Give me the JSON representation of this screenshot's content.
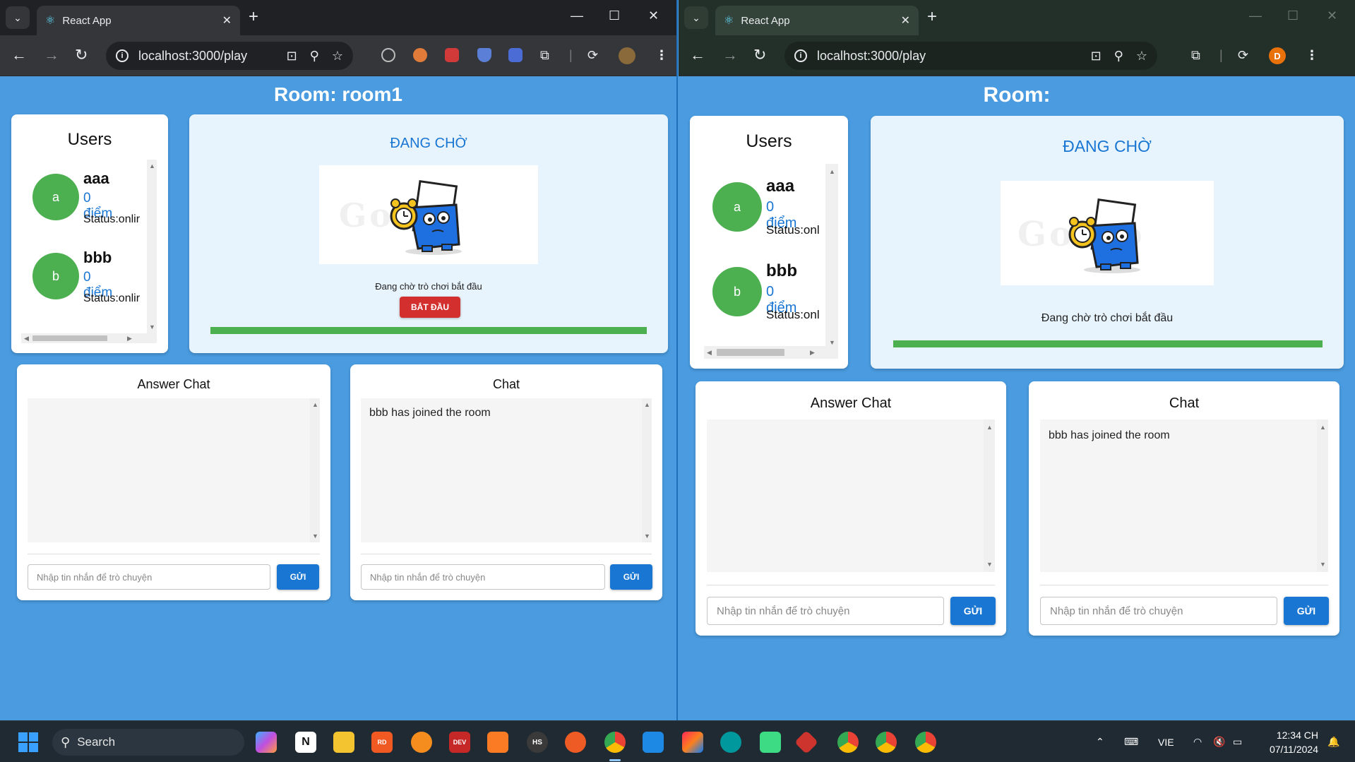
{
  "tab_title": "React App",
  "url": "localhost:3000/play",
  "windows": [
    {
      "room_title": "Room: room1",
      "users_title": "Users",
      "users": [
        {
          "initial": "a",
          "name": "aaa",
          "score": "0 điểm",
          "status": "Status:onlir"
        },
        {
          "initial": "b",
          "name": "bbb",
          "score": "0 điểm",
          "status": "Status:onlir"
        }
      ],
      "waiting_title": "ĐANG CHỜ",
      "waiting_watermark": "Go  .io",
      "waiting_text": "Đang chờ trò chơi bắt đầu",
      "start_button": "BẮT ĐẦU",
      "progress": 1.0,
      "answer_chat": {
        "title": "Answer Chat",
        "messages": [],
        "placeholder": "Nhập tin nhắn để trò chuyện",
        "send": "GỬI"
      },
      "chat": {
        "title": "Chat",
        "messages": [
          "bbb has joined the room"
        ],
        "placeholder": "Nhập tin nhắn để trò chuyện",
        "send": "GỬI"
      }
    },
    {
      "room_title": "Room:",
      "users_title": "Users",
      "users": [
        {
          "initial": "a",
          "name": "aaa",
          "score": "0 điểm",
          "status": "Status:onl"
        },
        {
          "initial": "b",
          "name": "bbb",
          "score": "0 điểm",
          "status": "Status:onl"
        }
      ],
      "waiting_title": "ĐANG CHỜ",
      "waiting_watermark": "Go  .io",
      "waiting_text": "Đang chờ trò chơi bắt đầu",
      "progress": 1.0,
      "answer_chat": {
        "title": "Answer Chat",
        "messages": [],
        "placeholder": "Nhập tin nhắn để trò chuyện",
        "send": "GỬI"
      },
      "chat": {
        "title": "Chat",
        "messages": [
          "bbb has joined the room"
        ],
        "placeholder": "Nhập tin nhắn để trò chuyện",
        "send": "GỬI"
      }
    }
  ],
  "right_profile_initial": "D",
  "taskbar": {
    "search_label": "Search",
    "language": "VIE",
    "time": "12:34 CH",
    "date": "07/11/2024",
    "apps": [
      "copilot",
      "notion",
      "file-explorer",
      "reader",
      "brave",
      "dev-cpp",
      "xampp",
      "hs",
      "postman",
      "chrome",
      "vscode",
      "jetbrains",
      "arduino",
      "android-studio",
      "ruby",
      "chrome-profile-d",
      "chrome-profile-2",
      "chrome-profile-3"
    ]
  },
  "colors": {
    "page_bg": "#4a9be0",
    "primary": "#1976d2",
    "avatar": "#4caf50",
    "danger": "#d32f2f"
  }
}
